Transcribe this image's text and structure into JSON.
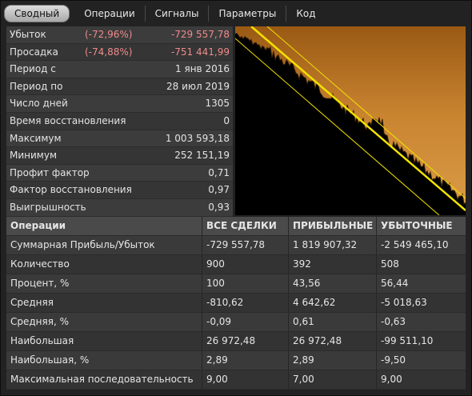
{
  "tabs": [
    "Сводный",
    "Операции",
    "Сигналы",
    "Параметры",
    "Код"
  ],
  "stats": [
    {
      "label": "Убыток",
      "pct": "(-72,96%)",
      "value": "-729 557,78",
      "neg": true
    },
    {
      "label": "Просадка",
      "pct": "(-74,88%)",
      "value": "-751 441,99",
      "neg": true
    },
    {
      "label": "Период с",
      "pct": "",
      "value": "1 янв 2016",
      "neg": false
    },
    {
      "label": "Период по",
      "pct": "",
      "value": "28 июл 2019",
      "neg": false
    },
    {
      "label": "Число дней",
      "pct": "",
      "value": "1305",
      "neg": false
    },
    {
      "label": "Время восстановления",
      "pct": "",
      "value": "0",
      "neg": false
    },
    {
      "label": "Максимум",
      "pct": "",
      "value": "1 003 593,18",
      "neg": false
    },
    {
      "label": "Минимум",
      "pct": "",
      "value": "252 151,19",
      "neg": false
    },
    {
      "label": "Профит фактор",
      "pct": "",
      "value": "0,71",
      "neg": false
    },
    {
      "label": "Фактор восстановления",
      "pct": "",
      "value": "0,97",
      "neg": false
    },
    {
      "label": "Выигрышность",
      "pct": "",
      "value": "0,93",
      "neg": false
    }
  ],
  "colors": {
    "equity_fill": "#c87d28",
    "channel_line": "#f2e200",
    "negative_text": "#f08a8a"
  },
  "table": {
    "headers": [
      "Операции",
      "ВСЕ СДЕЛКИ",
      "ПРИБЫЛЬНЫЕ",
      "УБЫТОЧНЫЕ"
    ],
    "rows": [
      [
        "Суммарная Прибыль/Убыток",
        "-729 557,78",
        "1 819 907,32",
        "-2 549 465,10"
      ],
      [
        "Количество",
        "900",
        "392",
        "508"
      ],
      [
        "Процент, %",
        "100",
        "43,56",
        "56,44"
      ],
      [
        "Средняя",
        "-810,62",
        "4 642,62",
        "-5 018,63"
      ],
      [
        "Средняя, %",
        "-0,09",
        "0,61",
        "-0,63"
      ],
      [
        "Наибольшая",
        "26 972,48",
        "26 972,48",
        "-99 511,10"
      ],
      [
        "Наибольшая, %",
        "2,89",
        "2,89",
        "-9,50"
      ],
      [
        "Максимальная последовательность",
        "9,00",
        "7,00",
        "9,00"
      ]
    ]
  }
}
